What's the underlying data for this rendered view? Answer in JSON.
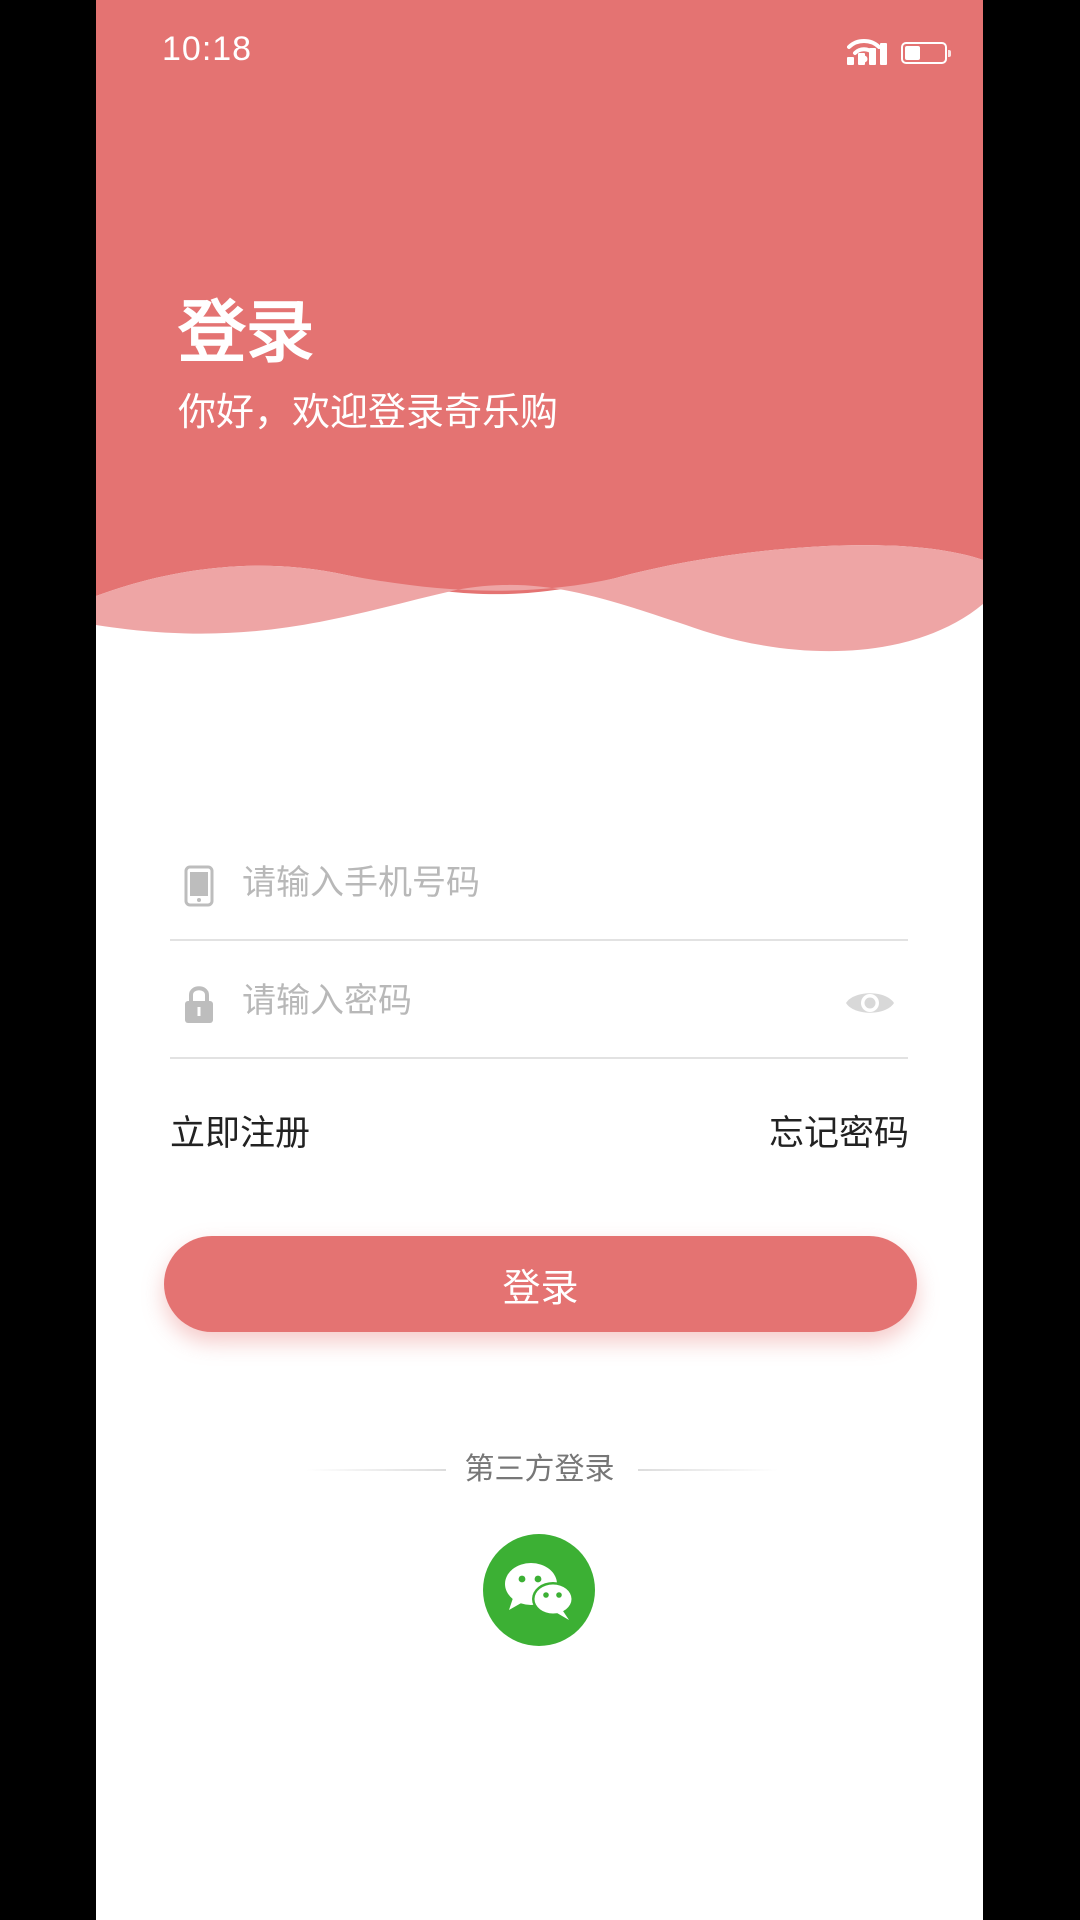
{
  "status_bar": {
    "time": "10:18",
    "battery_level": 0.35
  },
  "colors": {
    "primary": "#e47372",
    "wave_light": "#eea5a5",
    "wechat_green": "#3cb034",
    "placeholder": "#b8b8b8"
  },
  "header": {
    "title": "登录",
    "subtitle": "你好，欢迎登录奇乐购"
  },
  "form": {
    "phone": {
      "icon": "phone-icon",
      "placeholder": "请输入手机号码",
      "value": ""
    },
    "password": {
      "icon": "lock-icon",
      "placeholder": "请输入密码",
      "value": "",
      "visibility_icon": "eye-icon"
    },
    "register_link": "立即注册",
    "forgot_link": "忘记密码",
    "submit_label": "登录"
  },
  "third_party": {
    "label": "第三方登录",
    "providers": [
      {
        "icon": "wechat-icon"
      }
    ]
  }
}
